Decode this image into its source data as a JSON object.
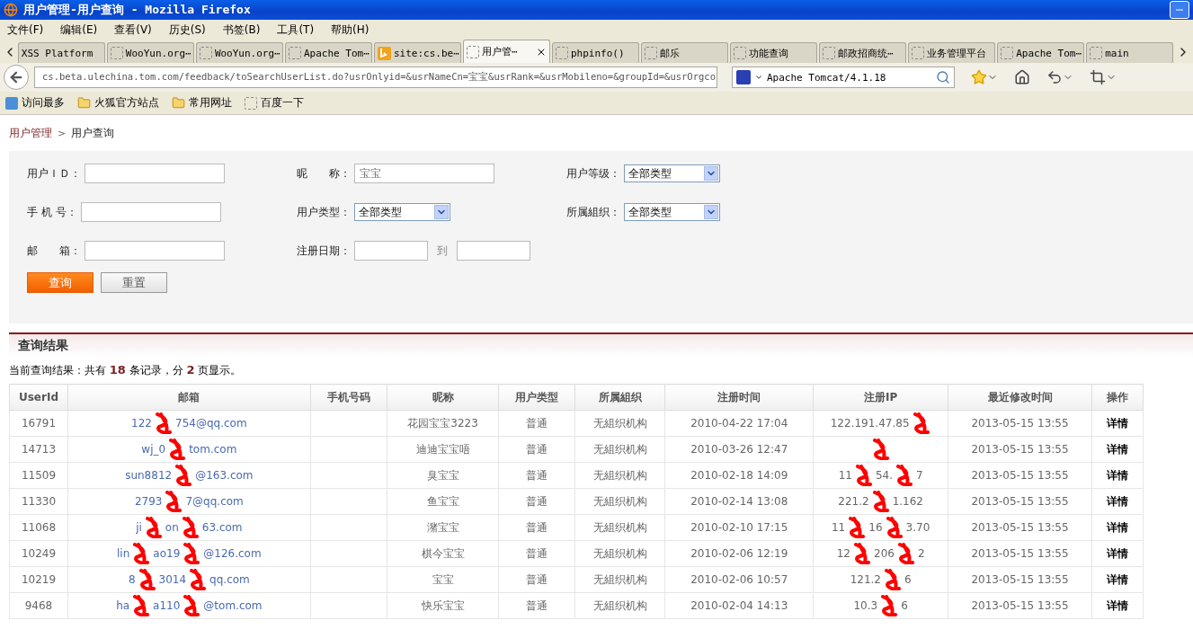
{
  "window": {
    "title": "用户管理-用户查询 - Mozilla Firefox"
  },
  "menu": [
    "文件(F)",
    "编辑(E)",
    "查看(V)",
    "历史(S)",
    "书签(B)",
    "工具(T)",
    "帮助(H)"
  ],
  "tabs": [
    {
      "label": "XSS Platform",
      "kind": "plain",
      "selected": false
    },
    {
      "label": "WooYun.org⋯",
      "kind": "page",
      "selected": false
    },
    {
      "label": "WooYun.org⋯",
      "kind": "page",
      "selected": false
    },
    {
      "label": "Apache Tom⋯",
      "kind": "page",
      "selected": false
    },
    {
      "label": "site:cs.be⋯",
      "kind": "bing",
      "selected": false
    },
    {
      "label": "用户管⋯",
      "kind": "page",
      "selected": true
    },
    {
      "label": "phpinfo()",
      "kind": "page",
      "selected": false
    },
    {
      "label": "邮乐",
      "kind": "page",
      "selected": false
    },
    {
      "label": "功能查询",
      "kind": "page",
      "selected": false
    },
    {
      "label": "邮政招商统⋯",
      "kind": "page",
      "selected": false
    },
    {
      "label": "业务管理平台",
      "kind": "page",
      "selected": false
    },
    {
      "label": "Apache Tom⋯",
      "kind": "page",
      "selected": false
    },
    {
      "label": "main",
      "kind": "page",
      "selected": false
    }
  ],
  "address": {
    "url": "cs.beta.ulechina.tom.com/feedback/toSearchUserList.do?usrOnlyid=&usrNameCn=宝宝&usrRank=&usrMobileno=&groupId=&usrOrgco"
  },
  "search": {
    "value": "Apache Tomcat/4.1.18"
  },
  "bookmarks": [
    {
      "label": "访问最多",
      "kind": "smart"
    },
    {
      "label": "火狐官方站点",
      "kind": "folder"
    },
    {
      "label": "常用网址",
      "kind": "folder"
    },
    {
      "label": "百度一下",
      "kind": "page"
    }
  ],
  "breadcrumb": [
    {
      "label": "用户管理",
      "kind": "link"
    },
    {
      "label": ">",
      "kind": "separator"
    },
    {
      "label": "用户查询",
      "kind": "current"
    }
  ],
  "form": [
    [
      {
        "label": "用户ＩＤ：",
        "kind": "text"
      },
      {
        "label": "昵　　称：",
        "kind": "text",
        "value": "宝宝"
      },
      {
        "label": "用户等级：",
        "kind": "select",
        "value": "全部类型"
      }
    ],
    [
      {
        "label": "手 机 号：",
        "kind": "text"
      },
      {
        "label": "用户类型：",
        "kind": "select",
        "value": "全部类型"
      },
      {
        "label": "所属組织：",
        "kind": "select",
        "value": "全部类型"
      }
    ],
    [
      {
        "label": "邮　　箱：",
        "kind": "text"
      },
      {
        "label": "注册日期：",
        "kind": "daterange",
        "separator": "到"
      }
    ]
  ],
  "buttons": [
    {
      "label": "查询",
      "kind": "primary"
    },
    {
      "label": "重置",
      "kind": "secondary"
    }
  ],
  "results": {
    "title": "查询结果",
    "summary": "当前查询结果：共有 **18** 条记录，分 **2** 页显示。"
  },
  "table": {
    "columns": [
      "UserId",
      "邮箱",
      "手机号码",
      "昵称",
      "用户类型",
      "所属組织",
      "注册时间",
      "注册IP",
      "最近修改时间",
      "操作"
    ],
    "rows": [
      {
        "user_id": "16791",
        "email": [
          "122",
          "754@qq.com"
        ],
        "nickname": "花园宝宝3223",
        "type": "普通",
        "org": "无組织机构",
        "registered": "2010-04-22 17:04",
        "ip": [
          "122.191.47.85"
        ],
        "modified": "2013-05-15 13:55",
        "action": "详情"
      },
      {
        "user_id": "14713",
        "email": [
          "wj_0",
          "tom.com"
        ],
        "nickname": "迪迪宝宝唔",
        "type": "普通",
        "org": "无組织机构",
        "registered": "2010-03-26 12:47",
        "ip": [],
        "modified": "2013-05-15 13:55",
        "action": "详情"
      },
      {
        "user_id": "11509",
        "email": [
          "sun8812",
          "@163.com"
        ],
        "nickname": "臭宝宝",
        "type": "普通",
        "org": "无組织机构",
        "registered": "2010-02-18 14:09",
        "ip": [
          "11",
          "54.",
          "7"
        ],
        "modified": "2013-05-15 13:55",
        "action": "详情"
      },
      {
        "user_id": "11330",
        "email": [
          "2793",
          "7@qq.com"
        ],
        "nickname": "鱼宝宝",
        "type": "普通",
        "org": "无組织机构",
        "registered": "2010-02-14 13:08",
        "ip": [
          "221.2",
          "1.162"
        ],
        "modified": "2013-05-15 13:55",
        "action": "详情"
      },
      {
        "user_id": "11068",
        "email": [
          "ji",
          "on",
          "63.com"
        ],
        "nickname": "潴宝宝",
        "type": "普通",
        "org": "无組织机构",
        "registered": "2010-02-10 17:15",
        "ip": [
          "11",
          "16",
          "3.70"
        ],
        "modified": "2013-05-15 13:55",
        "action": "详情"
      },
      {
        "user_id": "10249",
        "email": [
          "lin",
          "ao19",
          "@126.com"
        ],
        "nickname": "棋今宝宝",
        "type": "普通",
        "org": "无組织机构",
        "registered": "2010-02-06 12:19",
        "ip": [
          "12",
          "206",
          "2"
        ],
        "modified": "2013-05-15 13:55",
        "action": "详情"
      },
      {
        "user_id": "10219",
        "email": [
          "8",
          "3014",
          "qq.com"
        ],
        "nickname": "宝宝",
        "type": "普通",
        "org": "无組织机构",
        "registered": "2010-02-06 10:57",
        "ip": [
          "121.2",
          "6"
        ],
        "modified": "2013-05-15 13:55",
        "action": "详情"
      },
      {
        "user_id": "9468",
        "email": [
          "ha",
          "a110",
          "@tom.com"
        ],
        "nickname": "快乐宝宝",
        "type": "普通",
        "org": "无組织机构",
        "registered": "2010-02-04 14:13",
        "ip": [
          "10.3",
          "6"
        ],
        "modified": "2013-05-15 13:55",
        "action": "详情"
      }
    ]
  }
}
